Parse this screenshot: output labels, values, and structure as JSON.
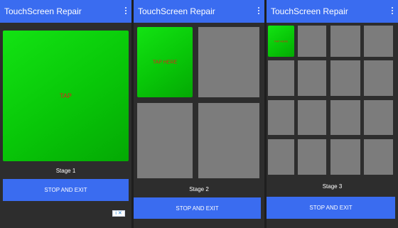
{
  "app": {
    "title": "TouchScreen Repair",
    "menu_icon": "more-vert-icon"
  },
  "accent": "#3a6cf0",
  "target_color": "#08c608",
  "tap_text_color": "#d8261c",
  "screens": [
    {
      "target_label": "TAP",
      "stage": "Stage 1",
      "exit": "STOP AND EXIT",
      "grid": "1x1"
    },
    {
      "target_label": "TAP HERE",
      "stage": "Stage 2",
      "exit": "STOP AND EXIT",
      "grid": "2x2"
    },
    {
      "target_label": "TAP HERE",
      "stage": "Stage 3",
      "exit": "STOP AND EXIT",
      "grid": "4x4"
    }
  ],
  "ad_choices": "i ✕"
}
